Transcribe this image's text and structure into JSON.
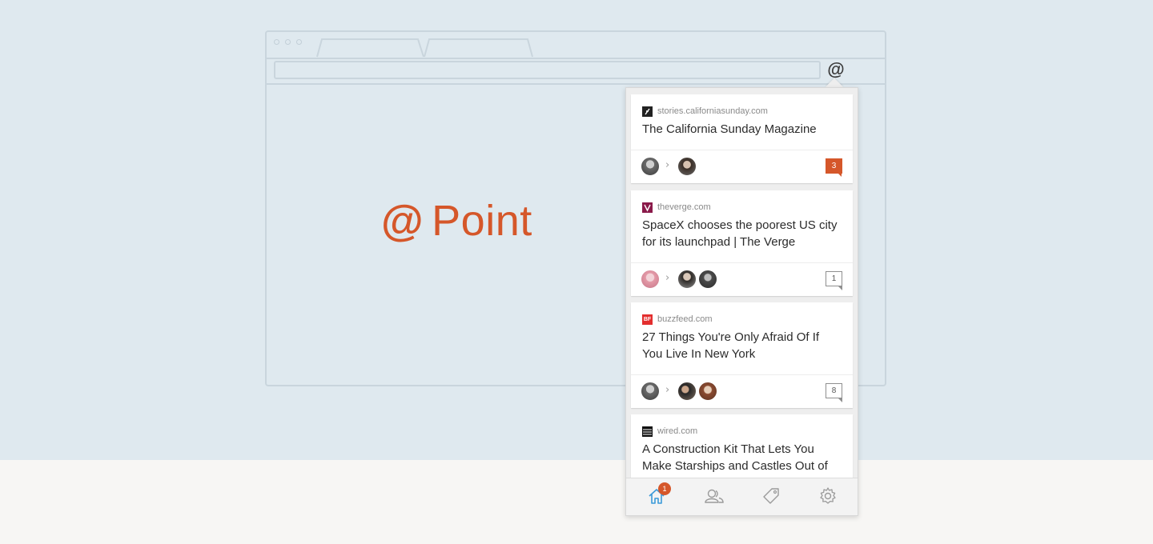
{
  "brand": {
    "at": "@",
    "name": "Point",
    "color": "#d5572a"
  },
  "browser": {
    "extension_glyph": "@"
  },
  "popup": {
    "items": [
      {
        "domain": "stories.californiasunday.com",
        "favicon": "californiasunday-favicon",
        "title": "The California Sunday Magazine",
        "comments": "3",
        "unread": true
      },
      {
        "domain": "theverge.com",
        "favicon": "verge-favicon",
        "title": "SpaceX chooses the poorest US city for its launchpad | The Verge",
        "comments": "1",
        "unread": false
      },
      {
        "domain": "buzzfeed.com",
        "favicon": "buzzfeed-favicon",
        "favicon_text": "BF",
        "title": "27 Things You're Only Afraid Of If You Live In New York",
        "comments": "8",
        "unread": false
      },
      {
        "domain": "wired.com",
        "favicon": "wired-favicon",
        "title": "A Construction Kit That Lets You Make Starships and Castles Out of Cardboard | WIRED"
      }
    ],
    "nav": {
      "home_badge": "1",
      "active": "home",
      "icons": [
        "home-icon",
        "friends-icon",
        "tag-icon",
        "settings-icon"
      ]
    }
  },
  "colors": {
    "accent": "#d5572a",
    "nav_active": "#3b9ad9",
    "background": "#dfe9ef"
  }
}
